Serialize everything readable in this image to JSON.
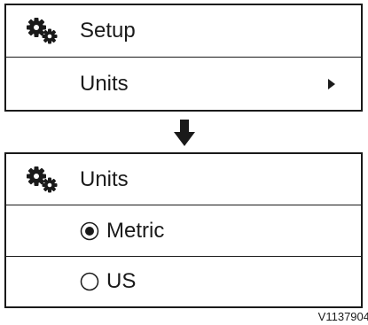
{
  "top_panel": {
    "header_title": "Setup",
    "menu_item_label": "Units"
  },
  "bottom_panel": {
    "header_title": "Units",
    "options": [
      {
        "label": "Metric",
        "selected": true
      },
      {
        "label": "US",
        "selected": false
      }
    ]
  },
  "figure_code": "V1137904",
  "icons": {
    "header": "gears-icon",
    "submenu": "triangle-right-icon",
    "transition": "arrow-down-icon"
  }
}
